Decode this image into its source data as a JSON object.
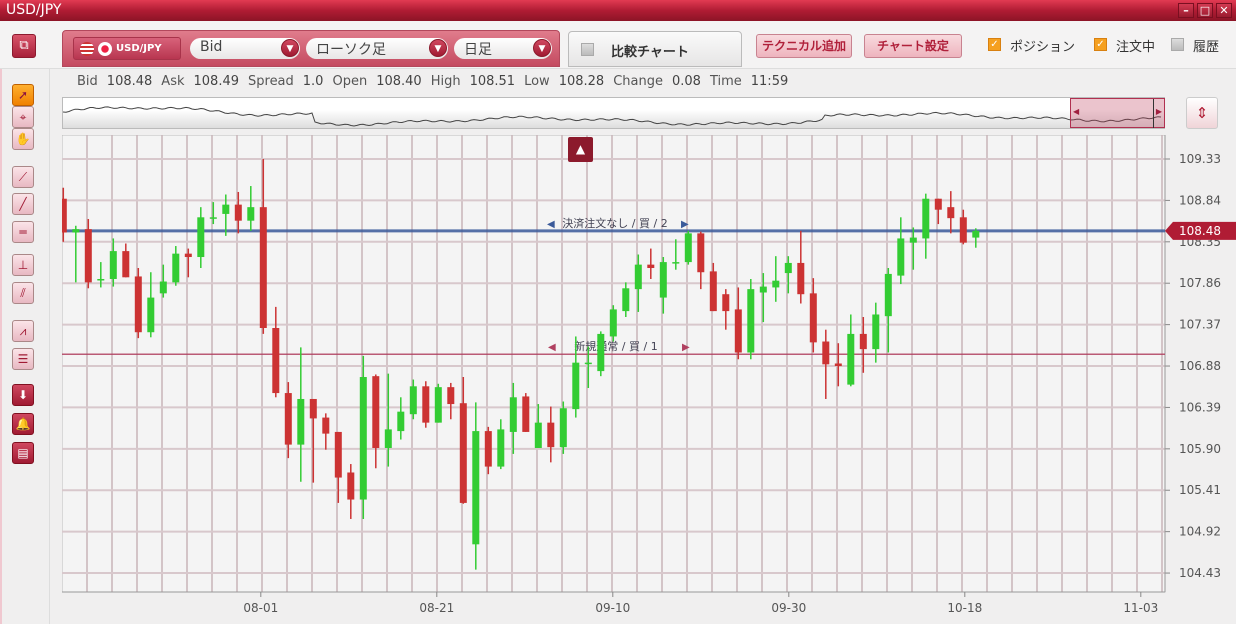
{
  "window": {
    "title": "USD/JPY",
    "controls": [
      "minimize",
      "maximize",
      "close"
    ]
  },
  "toolbar": {
    "pair": "USD/JPY",
    "price_type": "Bid",
    "chart_type": "ローソク足",
    "period": "日足",
    "compare_tab": "比較チャート",
    "add_technical": "テクニカル追加",
    "chart_settings": "チャート設定",
    "checkboxes": [
      {
        "label": "ポジション",
        "checked": true
      },
      {
        "label": "注文中",
        "checked": true
      },
      {
        "label": "履歴",
        "checked": false
      }
    ]
  },
  "quote": [
    {
      "label": "Bid",
      "value": "108.48"
    },
    {
      "label": "Ask",
      "value": "108.49"
    },
    {
      "label": "Spread",
      "value": "1.0"
    },
    {
      "label": "Open",
      "value": "108.40"
    },
    {
      "label": "High",
      "value": "108.51"
    },
    {
      "label": "Low",
      "value": "108.28"
    },
    {
      "label": "Change",
      "value": "0.08"
    },
    {
      "label": "Time",
      "value": "11:59"
    }
  ],
  "left_tools": [
    "select-arrow",
    "crosshair",
    "hand-pan",
    "trend-line",
    "line",
    "horizontal-line",
    "vertical-line",
    "parallel-lines",
    "fibonacci-fan",
    "fibonacci-retracement",
    "down-arrow",
    "alert-bell",
    "list"
  ],
  "colors": {
    "up": "#33cc33",
    "down": "#cc3333",
    "accent": "#b01c34",
    "order_line": "#3a5a9a",
    "position_line": "#b04060"
  },
  "chart_data": {
    "type": "candlestick",
    "ylim": [
      104.25,
      109.6
    ],
    "yticks": [
      "109.33",
      "108.84",
      "108.35",
      "107.86",
      "107.37",
      "106.88",
      "106.39",
      "105.90",
      "105.41",
      "104.92",
      "104.43"
    ],
    "xticks": [
      "08-01",
      "08-21",
      "09-10",
      "09-30",
      "10-18",
      "11-03"
    ],
    "current_price": "108.48",
    "lines": [
      {
        "price": 108.48,
        "label": "決済注文なし / 買 / 2",
        "color": "#3a5a9a"
      },
      {
        "price": 107.02,
        "label": "新規通常 / 買 / 1",
        "color": "#b04060"
      }
    ],
    "ohlc": [
      [
        108.86,
        108.99,
        108.35,
        108.46
      ],
      [
        108.46,
        108.54,
        107.87,
        108.5
      ],
      [
        108.5,
        108.62,
        107.8,
        107.87
      ],
      [
        107.91,
        108.11,
        107.81,
        107.91
      ],
      [
        107.91,
        108.39,
        107.82,
        108.24
      ],
      [
        108.24,
        108.33,
        107.93,
        107.93
      ],
      [
        107.94,
        108.04,
        107.21,
        107.28
      ],
      [
        107.28,
        107.99,
        107.22,
        107.69
      ],
      [
        107.74,
        108.08,
        107.69,
        107.88
      ],
      [
        107.87,
        108.3,
        107.83,
        108.21
      ],
      [
        108.21,
        108.27,
        107.93,
        108.17
      ],
      [
        108.17,
        108.76,
        108.04,
        108.64
      ],
      [
        108.64,
        108.82,
        108.56,
        108.64
      ],
      [
        108.68,
        108.91,
        108.42,
        108.79
      ],
      [
        108.79,
        108.94,
        108.45,
        108.6
      ],
      [
        108.6,
        109.01,
        108.48,
        108.76
      ],
      [
        108.76,
        109.33,
        107.26,
        107.33
      ],
      [
        107.33,
        107.58,
        106.51,
        106.56
      ],
      [
        106.56,
        106.69,
        105.79,
        105.95
      ],
      [
        105.95,
        107.1,
        105.51,
        106.49
      ],
      [
        106.49,
        106.49,
        105.5,
        106.26
      ],
      [
        106.27,
        106.32,
        105.89,
        106.08
      ],
      [
        106.1,
        106.1,
        105.26,
        105.56
      ],
      [
        105.62,
        105.72,
        105.07,
        105.3
      ],
      [
        105.3,
        107.0,
        105.07,
        106.75
      ],
      [
        106.76,
        106.78,
        105.67,
        105.91
      ],
      [
        105.91,
        106.79,
        105.69,
        106.13
      ],
      [
        106.11,
        106.51,
        106.01,
        106.34
      ],
      [
        106.31,
        106.72,
        106.25,
        106.64
      ],
      [
        106.64,
        106.7,
        106.15,
        106.21
      ],
      [
        106.21,
        106.67,
        106.21,
        106.63
      ],
      [
        106.63,
        106.68,
        106.25,
        106.43
      ],
      [
        106.44,
        106.75,
        105.25,
        105.26
      ],
      [
        104.77,
        106.45,
        104.47,
        106.11
      ],
      [
        106.11,
        106.16,
        105.6,
        105.69
      ],
      [
        105.69,
        106.25,
        105.66,
        106.13
      ],
      [
        106.1,
        106.68,
        105.84,
        106.51
      ],
      [
        106.52,
        106.56,
        106.1,
        106.1
      ],
      [
        105.91,
        106.43,
        105.91,
        106.21
      ],
      [
        106.21,
        106.4,
        105.74,
        105.92
      ],
      [
        105.92,
        106.46,
        105.84,
        106.38
      ],
      [
        106.37,
        107.23,
        106.27,
        106.92
      ],
      [
        106.92,
        107.11,
        106.62,
        106.92
      ],
      [
        106.82,
        107.29,
        106.76,
        107.26
      ],
      [
        107.23,
        107.6,
        107.17,
        107.55
      ],
      [
        107.53,
        107.87,
        107.46,
        107.8
      ],
      [
        107.79,
        108.2,
        107.52,
        108.08
      ],
      [
        108.08,
        108.27,
        107.91,
        108.04
      ],
      [
        107.69,
        108.17,
        107.5,
        108.11
      ],
      [
        108.11,
        108.38,
        108.02,
        108.11
      ],
      [
        108.11,
        108.48,
        108.08,
        108.45
      ],
      [
        108.45,
        108.47,
        107.79,
        107.99
      ],
      [
        108.0,
        108.1,
        107.53,
        107.53
      ],
      [
        107.73,
        107.79,
        107.31,
        107.53
      ],
      [
        107.55,
        107.81,
        106.96,
        107.04
      ],
      [
        107.04,
        107.91,
        106.96,
        107.79
      ],
      [
        107.75,
        107.98,
        107.4,
        107.82
      ],
      [
        107.81,
        108.18,
        107.64,
        107.89
      ],
      [
        107.98,
        108.18,
        107.74,
        108.1
      ],
      [
        108.1,
        108.48,
        107.62,
        107.73
      ],
      [
        107.74,
        107.92,
        107.04,
        107.16
      ],
      [
        107.17,
        107.31,
        106.49,
        106.9
      ],
      [
        106.91,
        107.15,
        106.64,
        106.88
      ],
      [
        106.66,
        107.49,
        106.64,
        107.26
      ],
      [
        107.26,
        107.46,
        106.8,
        107.08
      ],
      [
        107.08,
        107.63,
        106.92,
        107.49
      ],
      [
        107.47,
        108.04,
        107.04,
        107.97
      ],
      [
        107.95,
        108.64,
        107.85,
        108.39
      ],
      [
        108.34,
        108.52,
        108.02,
        108.4
      ],
      [
        108.39,
        108.92,
        108.15,
        108.86
      ],
      [
        108.86,
        108.86,
        108.56,
        108.73
      ],
      [
        108.76,
        108.95,
        108.45,
        108.63
      ],
      [
        108.64,
        108.73,
        108.32,
        108.34
      ],
      [
        108.4,
        108.51,
        108.28,
        108.48
      ]
    ]
  }
}
